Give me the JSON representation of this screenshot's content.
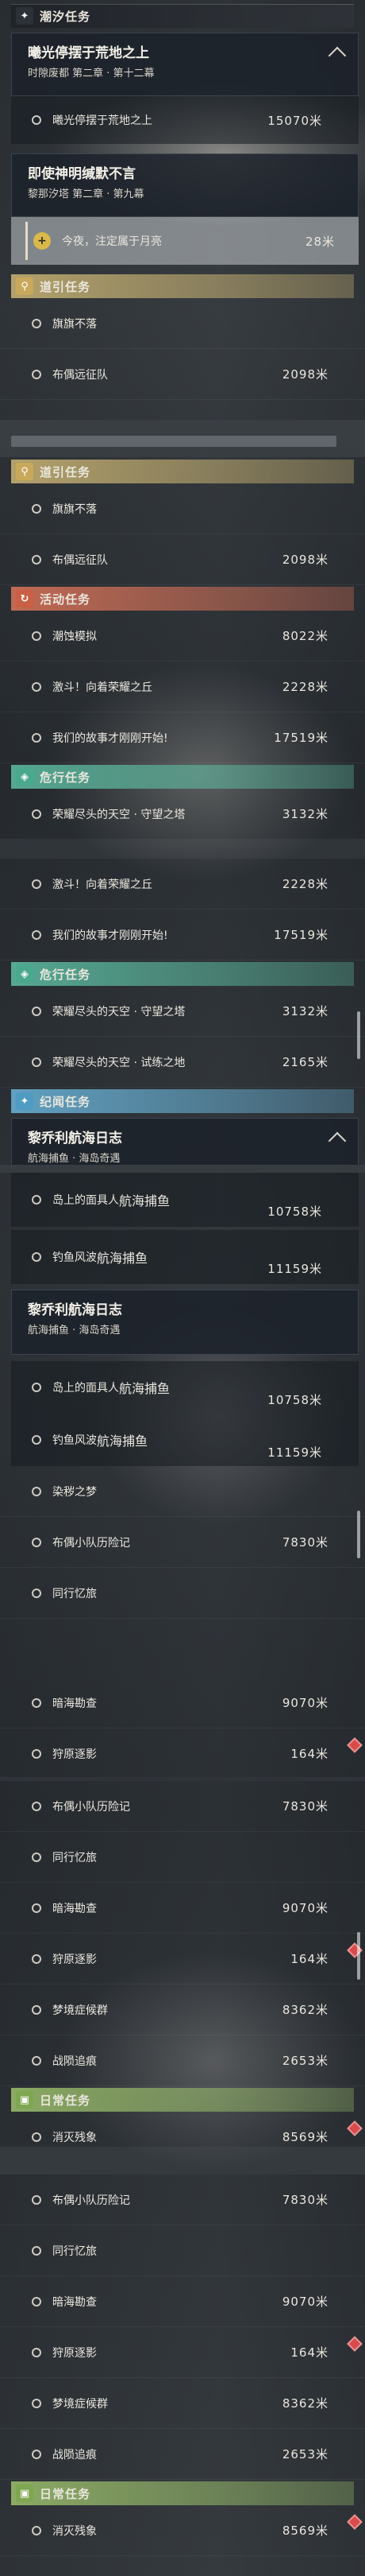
{
  "sections": {
    "chaoxi": {
      "title": "潮汐任务"
    },
    "daoyin": {
      "title": "道引任务"
    },
    "huodong": {
      "title": "活动任务"
    },
    "weixing": {
      "title": "危行任务"
    },
    "jiwen": {
      "title": "纪闻任务"
    },
    "richang": {
      "title": "日常任务"
    }
  },
  "cards": {
    "c1": {
      "title": "曦光停摆于荒地之上",
      "subtitle": "时隙废都 第二章 · 第十二幕"
    },
    "c2": {
      "title": "即使神明缄默不言",
      "subtitle": "黎那汐塔 第二章 · 第九幕"
    },
    "c3": {
      "title": "黎乔利航海日志",
      "subtitle": "航海捕鱼 · 海岛奇遇"
    }
  },
  "badge": "航海捕鱼",
  "rows": {
    "r1": {
      "label": "曦光停摆于荒地之上",
      "value": "15070米"
    },
    "r2": {
      "label": "今夜，注定属于月亮",
      "value": "28米"
    },
    "r3": {
      "label": "旗旗不落",
      "value": ""
    },
    "r4": {
      "label": "布偶远征队",
      "value": "2098米"
    },
    "r5": {
      "label": "潮蚀模拟",
      "value": "8022米"
    },
    "r6": {
      "label": "激斗！向着荣耀之丘",
      "value": "2228米"
    },
    "r7": {
      "label": "我们的故事才刚刚开始!",
      "value": "17519米"
    },
    "r8": {
      "label": "荣耀尽头的天空 · 守望之塔",
      "value": "3132米"
    },
    "r9": {
      "label": "荣耀尽头的天空 · 试练之地",
      "value": "2165米"
    },
    "r10": {
      "label": "岛上的面具人",
      "value": "10758米"
    },
    "r11": {
      "label": "钓鱼风波",
      "value": "11159米"
    },
    "r12": {
      "label": "染秽之梦",
      "value": ""
    },
    "r13": {
      "label": "布偶小队历险记",
      "value": "7830米"
    },
    "r14": {
      "label": "同行忆旅",
      "value": ""
    },
    "r15": {
      "label": "暗海勘查",
      "value": "9070米"
    },
    "r16": {
      "label": "狩原逐影",
      "value": "164米"
    },
    "r17": {
      "label": "梦境症候群",
      "value": "8362米"
    },
    "r18": {
      "label": "战陨追痕",
      "value": "2653米"
    },
    "r19": {
      "label": "消灭残象",
      "value": "8569米"
    }
  },
  "colors": {
    "chaoxi": "#e8e2d2",
    "daoyin": "#d9c07a",
    "huodong": "#e0765a",
    "weixing": "#5fc2a6",
    "jiwen": "#6cb8de",
    "richang": "#9fc46e"
  }
}
